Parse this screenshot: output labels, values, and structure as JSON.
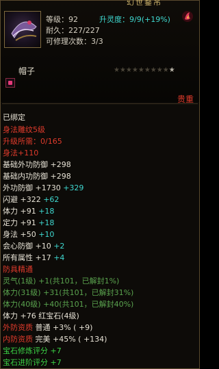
{
  "header": {
    "title": "幻世鍪吊",
    "level_label": "等级：",
    "level_value": "92",
    "upgrade_label": "升灵度：",
    "upgrade_value": "9/9",
    "upgrade_pct": "(+19%)",
    "durability_label": "耐久：",
    "durability_value": "227/227",
    "repair_label": "可修理次数：",
    "repair_value": "3/3",
    "item_type": "帽子",
    "rarity_label": "贵重"
  },
  "stats": {
    "bound": "已绑定",
    "skill": "身法雕纹5级",
    "upgrade_req_label": "升级所需：",
    "upgrade_req_value": "0/165",
    "body_method": "身法+110",
    "base_outer_def": "基础外功防御 +298",
    "base_inner_def": "基础内功防御 +298",
    "outer_def_base": "外功防御 +1730",
    "outer_def_bonus": "+329",
    "dodge_base": "闪避 +322",
    "dodge_bonus": "+62",
    "hp_base": "体力 +91",
    "hp_bonus": "+18",
    "focus_base": "定力 +91",
    "focus_bonus": "+18",
    "agility_base": "身法 +50",
    "agility_bonus": "+10",
    "heart_def_base": "会心防御 +10",
    "heart_def_bonus": "+2",
    "all_attr_base": "所有属性 +17",
    "all_attr_bonus": "+4",
    "refine_label": "防具精通",
    "refine_1": "灵气(1级) +1(共101，已解封1%)",
    "refine_2": "体力(31级) +31(共101，已解封31%)",
    "refine_3": "体力(40级) +40(共101，已解封40%)",
    "gem_line": "体力 +76 红宝石(4级)",
    "outer_quality_label": "外防资质",
    "outer_quality_grade": "普通",
    "outer_quality_val": "+3%",
    "outer_quality_extra": "( +9)",
    "inner_quality_label": "内防资质",
    "inner_quality_grade": "完美",
    "inner_quality_val": "+45%",
    "inner_quality_extra": "( +134)",
    "gem_refine_score": "宝石修炼评分 +7",
    "gem_advance_score": "宝石进阶评分 +7"
  },
  "colors": {
    "border": "#5a4a2e",
    "red": "#e03b2c",
    "cyan": "#3fd8d0",
    "green": "#3bd346",
    "orange": "#e6a030",
    "white": "#e8e3d6"
  },
  "icons": {
    "item": "helmet-item-icon",
    "badge": "flame-badge-icon",
    "gem": "red-gem-icon"
  }
}
